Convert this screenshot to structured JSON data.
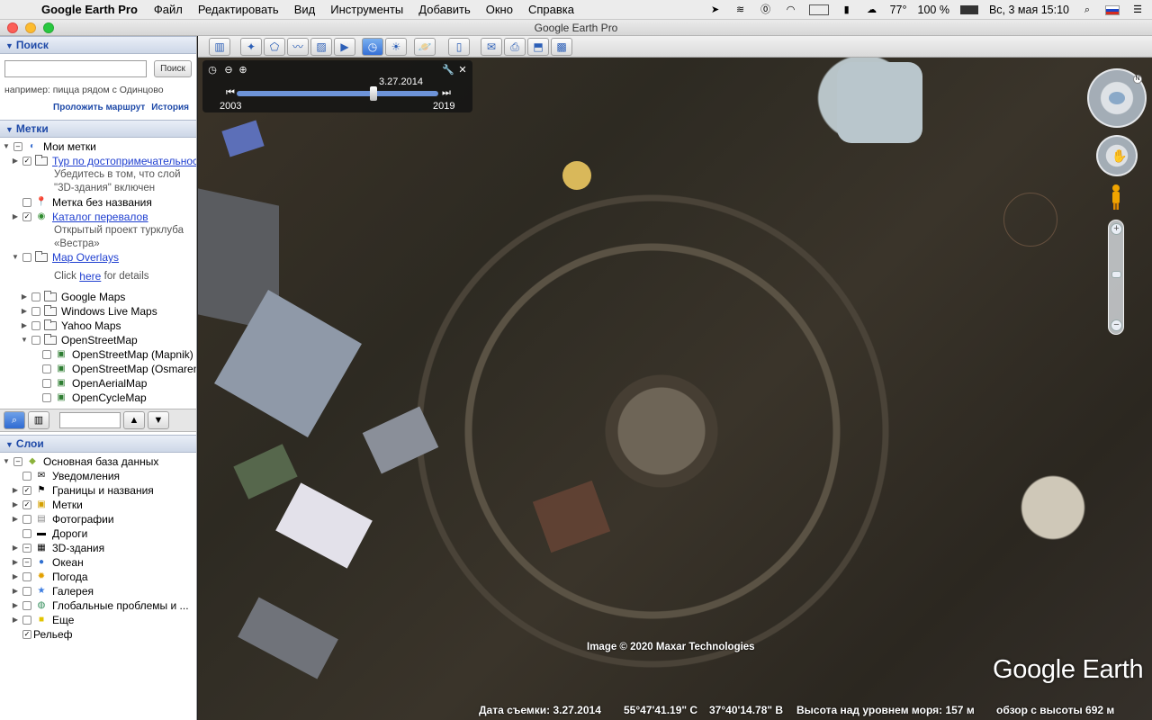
{
  "menubar": {
    "app_name": "Google Earth Pro",
    "items": [
      "Файл",
      "Редактировать",
      "Вид",
      "Инструменты",
      "Добавить",
      "Окно",
      "Справка"
    ],
    "temperature": "77°",
    "battery": "100 %",
    "datetime": "Вс, 3 мая  15:10"
  },
  "window": {
    "title": "Google Earth Pro"
  },
  "search": {
    "header": "Поиск",
    "input_value": "",
    "button_label": "Поиск",
    "hint": "например: пицца рядом с Одинцово",
    "directions_link": "Проложить маршрут",
    "history_link": "История"
  },
  "places": {
    "header": "Метки",
    "my_places": "Мои метки",
    "tour_label": "Тур по достопримечательностям",
    "tour_desc_1": "Убедитесь в том, что слой",
    "tour_desc_2": "\"3D-здания\" включен",
    "untitled_placemark": "Метка без названия",
    "passes_catalog": "Каталог перевалов",
    "passes_desc_1": "Открытый проект турклуба",
    "passes_desc_2": "«Вестра»",
    "map_overlays": "Map Overlays",
    "click_text": "Click",
    "here_link": "here",
    "for_details": "for details",
    "google_maps": "Google Maps",
    "windows_live": "Windows Live Maps",
    "yahoo_maps": "Yahoo Maps",
    "osm": "OpenStreetMap",
    "osm_mapnik": "OpenStreetMap (Mapnik)",
    "osm_osmarender": "OpenStreetMap (Osmarender)",
    "open_aerial": "OpenAerialMap",
    "open_cycle": "OpenCycleMap"
  },
  "layers": {
    "header": "Слои",
    "primary_db": "Основная база данных",
    "items": [
      "Уведомления",
      "Границы и названия",
      "Метки",
      "Фотографии",
      "Дороги",
      "3D-здания",
      "Океан",
      "Погода",
      "Галерея",
      "Глобальные проблемы и ...",
      "Еще",
      "Рельеф"
    ]
  },
  "time_slider": {
    "current_date": "3.27.2014",
    "start_year": "2003",
    "end_year": "2019",
    "position_fraction": 0.68
  },
  "map": {
    "attribution": "Image © 2020 Maxar Technologies",
    "logo": "Google Earth"
  },
  "status": {
    "imagery_date": "Дата съемки: 3.27.2014",
    "lat": "55°47'41.19\" С",
    "lon": "37°40'14.78\" В",
    "elevation": "Высота над уровнем моря:   157 м",
    "eye_alt": "обзор с высоты   692 м"
  }
}
